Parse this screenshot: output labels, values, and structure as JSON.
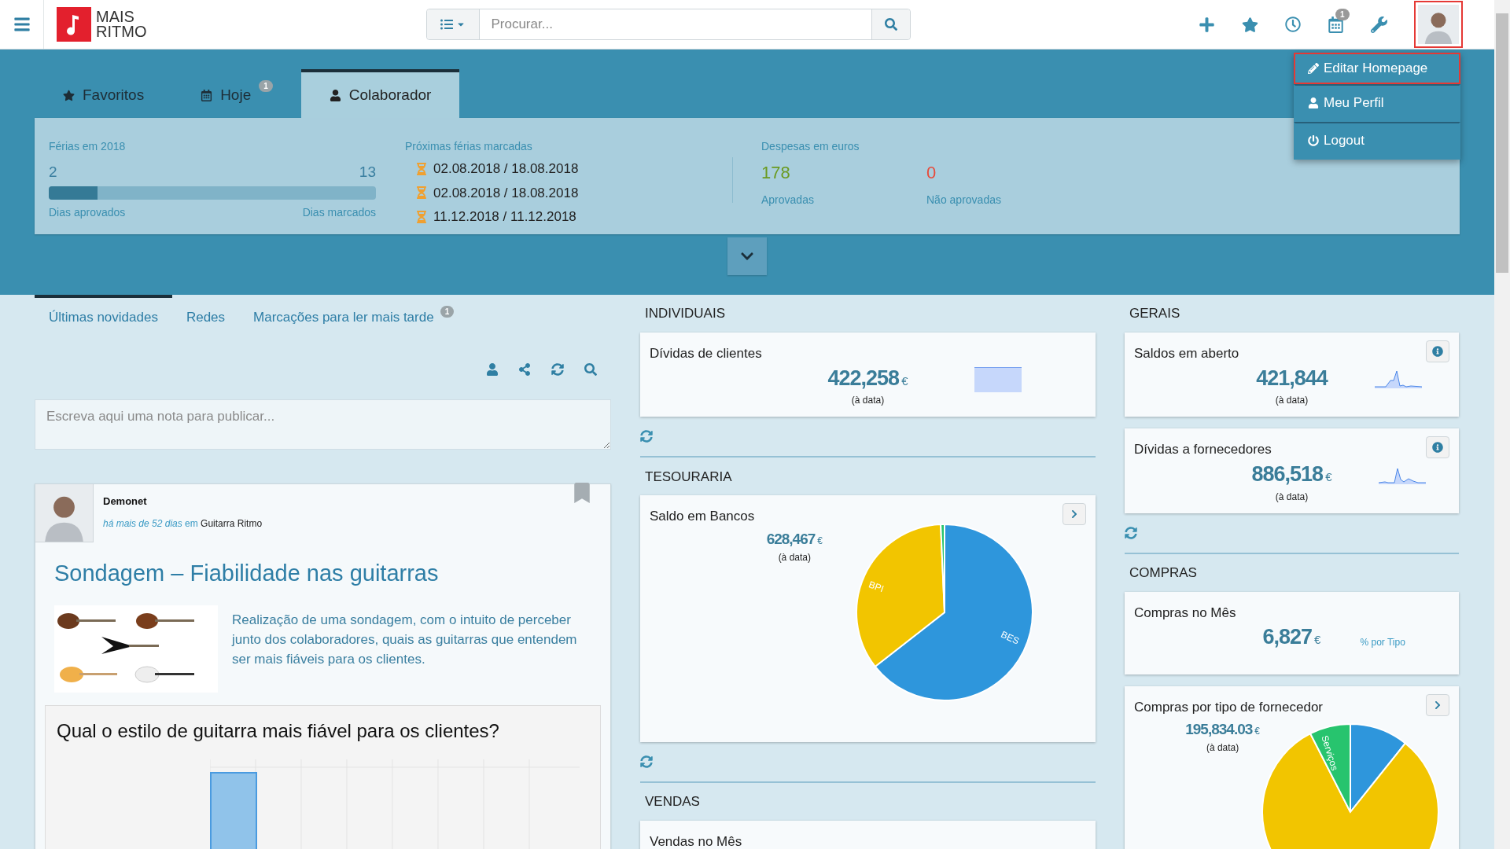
{
  "topbar": {
    "logo": {
      "line1": "MAIS",
      "line2": "RITMO"
    },
    "search": {
      "placeholder": "Procurar..."
    },
    "calendar_badge": "1",
    "avatar": {
      "highlighted": true
    }
  },
  "user_menu": [
    {
      "label": "Editar Homepage",
      "highlighted": true
    },
    {
      "label": "Meu Perfil",
      "highlighted": false
    },
    {
      "label": "Logout",
      "highlighted": false
    }
  ],
  "tabs": [
    {
      "label": "Favoritos",
      "selected": false
    },
    {
      "label": "Hoje",
      "badge": "1",
      "selected": false
    },
    {
      "label": "Colaborador",
      "selected": true
    }
  ],
  "summary": {
    "vacation": {
      "title": "Férias em 2018",
      "approved": "2",
      "marked": "13",
      "level": 0.15,
      "approved_label": "Dias aprovados",
      "marked_label": "Dias marcados"
    },
    "upcoming": {
      "title": "Próximas férias marcadas",
      "dates": [
        "02.08.2018 / 18.08.2018",
        "02.08.2018 / 18.08.2018",
        "11.12.2018 / 11.12.2018"
      ]
    },
    "expenses": {
      "title": "Despesas em euros",
      "approved": "178",
      "approved_label": "Aprovadas",
      "rejected": "0",
      "rejected_label": "Não aprovadas"
    }
  },
  "feed": {
    "tabs": [
      {
        "label": "Últimas novidades",
        "selected": true
      },
      {
        "label": "Redes",
        "selected": false
      },
      {
        "label": "Marcações para ler mais tarde",
        "badge": "1",
        "selected": false
      }
    ],
    "note": {
      "placeholder": "Escreva aqui uma nota para publicar..."
    },
    "post": {
      "author": "Demonet",
      "time": "há mais de 52 dias",
      "connector": "em",
      "group": "Guitarra Ritmo",
      "title": "Sondagem – Fiabilidade nas guitarras",
      "body": "Realização de uma sondagem, com o intuito de perceber junto dos colaboradores, quais as guitarras que entendem ser mais fiáveis para os clientes.",
      "poll": {
        "question": "Qual o estilo de guitarra mais fiável para os clientes?"
      }
    }
  },
  "columns": [
    [
      {
        "heading": "INDIVIDUAIS",
        "refresh": true,
        "widgets": [
          {
            "kind": "thumbnail",
            "title": "Dívidas de clientes",
            "value": "422,258",
            "currency": "€",
            "note": "(à data)"
          }
        ]
      },
      {
        "heading": "TESOURARIA",
        "refresh": true,
        "widgets": [
          {
            "kind": "pie",
            "title": "Saldo em Bancos",
            "value": "628,467",
            "currency": "€",
            "note": "(à data)",
            "slices": [
              {
                "label": "BES",
                "color": "#2e96dc"
              },
              {
                "label": "BPI",
                "color": "#f2c500"
              },
              {
                "color": "#27c46e"
              }
            ]
          }
        ]
      },
      {
        "heading": "VENDAS",
        "widgets": [
          {
            "kind": "plain",
            "title": "Vendas no Mês"
          }
        ]
      }
    ],
    [
      {
        "heading": "GERAIS",
        "refresh": true,
        "widgets": [
          {
            "kind": "sparkline",
            "title": "Saldos em aberto",
            "value": "421,844",
            "note": "(à data)"
          },
          {
            "kind": "sparkline",
            "title": "Dívidas a fornecedores",
            "value": "886,518",
            "currency": "€",
            "note": "(à data)"
          }
        ]
      },
      {
        "heading": "COMPRAS",
        "widgets": [
          {
            "kind": "plain",
            "title": "Compras no Mês",
            "value": "6,827",
            "currency": "€",
            "link": "% por Tipo"
          },
          {
            "kind": "pie",
            "title": "Compras por tipo de fornecedor",
            "value": "195,834.03",
            "currency": "€",
            "note": "(à data)",
            "slices": [
              {
                "color": "#2e96dc"
              },
              {
                "color": "#f2c500"
              },
              {
                "label": "Serviços",
                "color": "#27c46e"
              }
            ]
          }
        ]
      }
    ]
  ]
}
